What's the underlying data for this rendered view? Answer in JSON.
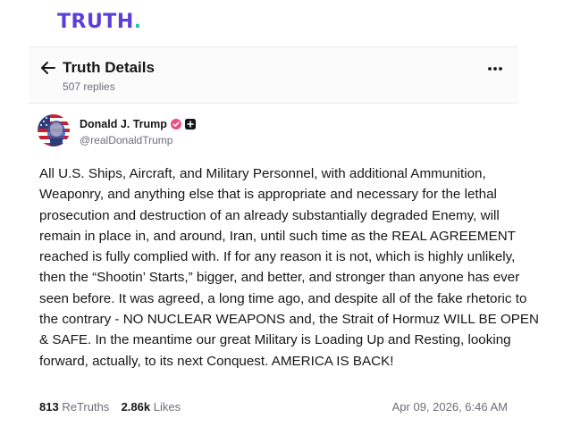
{
  "brand": {
    "logo_text": "TRUTH",
    "logo_dot": ".",
    "accent": "#5b3fd6",
    "dot_color": "#22c7b8"
  },
  "header": {
    "title": "Truth Details",
    "replies": "507 replies",
    "back_icon": "arrow-left-icon",
    "more_icon": "more-horizontal-icon",
    "more_glyph": "•••"
  },
  "post": {
    "author": {
      "name": "Donald J. Trump",
      "handle": "@realDonaldTrump",
      "verified_badge_color": "#e94f87",
      "avatar_icon": "flag-portrait-avatar"
    },
    "text": "All U.S. Ships, Aircraft, and Military Personnel, with additional Ammunition, Weaponry, and anything else that is appropriate and necessary for the lethal prosecution and destruction of an already substantially degraded Enemy, will remain in place in, and around, Iran, until such time as the REAL AGREEMENT reached is fully complied with. If for any reason it is not, which is highly unlikely, then the “Shootin’ Starts,” bigger, and better, and stronger than anyone has ever seen before. It was agreed, a long time ago, and despite all of the fake rhetoric to the contrary - NO NUCLEAR WEAPONS and, the Strait of Hormuz WILL BE OPEN & SAFE. In the meantime our great Military is Loading Up and Resting, looking forward, actually, to its next Conquest. AMERICA IS BACK!",
    "retruths_count": "813",
    "retruths_label": "ReTruths",
    "likes_count": "2.86k",
    "likes_label": "Likes",
    "timestamp": "Apr 09, 2026, 6:46 AM"
  }
}
